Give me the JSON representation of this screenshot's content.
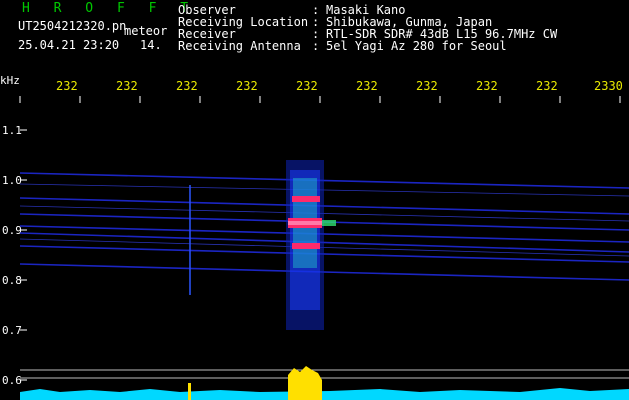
{
  "header": {
    "brand": "H R O F F T",
    "filename": "UT2504212320.pn",
    "tag": "meteor",
    "datetime": "25.04.21 23:20",
    "code": "14.",
    "rows": [
      {
        "label": "Observer",
        "value": "Masaki Kano"
      },
      {
        "label": "Receiving Location",
        "value": "Shibukawa, Gunma, Japan"
      },
      {
        "label": "Receiver",
        "value": "RTL-SDR SDR# 43dB L15 96.7MHz CW"
      },
      {
        "label": "Receiving Antenna",
        "value": "5el Yagi Az 280 for Seoul"
      }
    ],
    "separator": ":"
  },
  "axis": {
    "unit": "kHz",
    "time_ticks": [
      "232",
      "232",
      "232",
      "232",
      "232",
      "232",
      "232",
      "232",
      "232",
      "2330"
    ],
    "freq_labels": [
      "1.1",
      "1.0",
      "0.9",
      "0.8",
      "0.7",
      "0.6"
    ]
  },
  "colors": {
    "text_primary": "#ffffff",
    "text_accent": "#e8e800",
    "brand": "#00c800",
    "signal_trace": "#1e2ad8",
    "meteor_core": "#ff2a6a",
    "power_trace": "#00d8ff",
    "power_burst": "#ffe000"
  }
}
